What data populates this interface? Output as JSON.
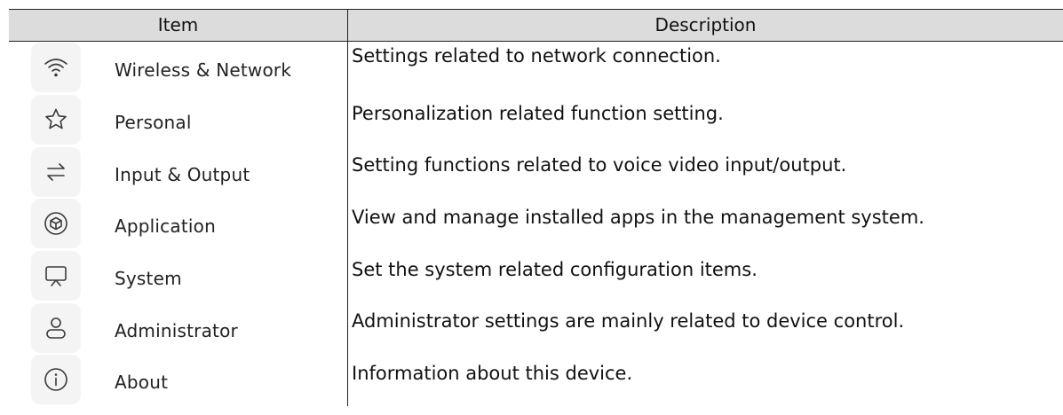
{
  "table": {
    "headers": {
      "item": "Item",
      "description": "Description"
    },
    "rows": [
      {
        "icon": "wifi-icon",
        "name": "Wireless & Network",
        "description": "Settings related to network connection."
      },
      {
        "icon": "star-icon",
        "name": "Personal",
        "description": "Personalization related function setting."
      },
      {
        "icon": "swap-arrows-icon",
        "name": "Input & Output",
        "description": "Setting functions related to voice video input/output."
      },
      {
        "icon": "cube-icon",
        "name": "Application",
        "description": "View and manage installed apps in the management system."
      },
      {
        "icon": "monitor-icon",
        "name": "System",
        "description": "Set the system related configuration items."
      },
      {
        "icon": "user-icon",
        "name": "Administrator",
        "description": "Administrator settings are mainly related to device control."
      },
      {
        "icon": "info-icon",
        "name": "About",
        "description": "Information about this device."
      }
    ]
  }
}
